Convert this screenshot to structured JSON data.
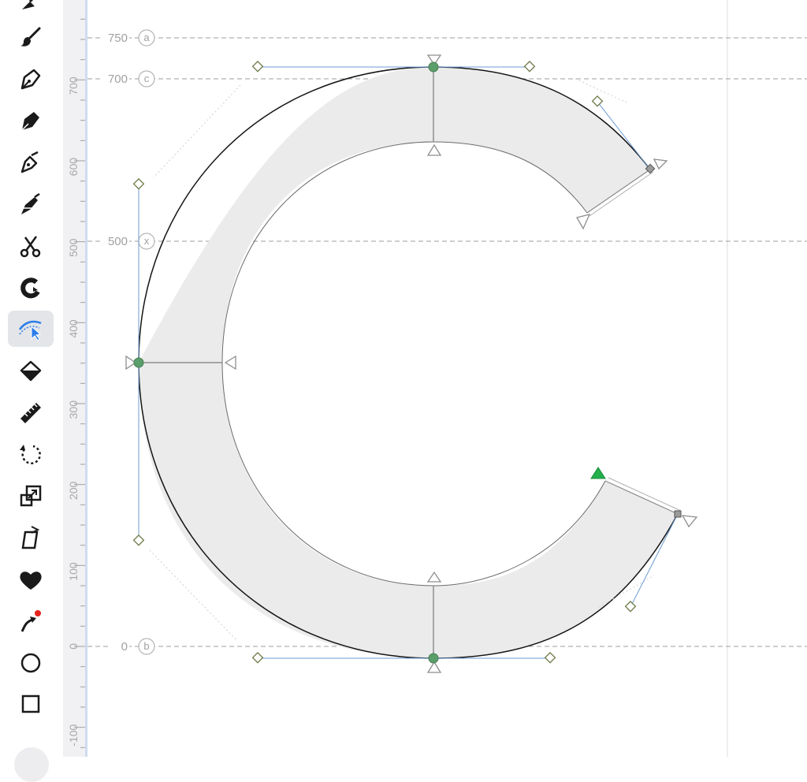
{
  "toolbar": {
    "tools": [
      {
        "name": "brush-tool",
        "icon": "brush-icon"
      },
      {
        "name": "pen-tool",
        "icon": "pen-icon"
      },
      {
        "name": "calligraphy-pen-tool",
        "icon": "calligraphy-pen-icon"
      },
      {
        "name": "fountain-pen-tool",
        "icon": "fountain-pen-icon"
      },
      {
        "name": "knife-pen-tool",
        "icon": "knife-pen-icon"
      },
      {
        "name": "scissors-tool",
        "icon": "scissors-icon"
      },
      {
        "name": "magnet-tool",
        "icon": "magnet-icon"
      },
      {
        "name": "curve-select-tool",
        "icon": "curve-select-icon",
        "active": true
      },
      {
        "name": "fill-tool",
        "icon": "paint-bucket-icon"
      },
      {
        "name": "measure-tool",
        "icon": "ruler-icon"
      },
      {
        "name": "rotate-tool",
        "icon": "rotate-icon"
      },
      {
        "name": "scale-tool",
        "icon": "scale-icon"
      },
      {
        "name": "slant-tool",
        "icon": "slant-icon"
      },
      {
        "name": "heart-shape-tool",
        "icon": "heart-icon"
      },
      {
        "name": "direction-tool",
        "icon": "direction-arrow-icon"
      },
      {
        "name": "ellipse-tool",
        "icon": "circle-icon"
      },
      {
        "name": "rectangle-tool",
        "icon": "square-icon"
      }
    ],
    "accent_color": "#2b7de9"
  },
  "ruler": {
    "ticks": [
      "700",
      "600",
      "500",
      "400",
      "300",
      "200",
      "100",
      "0",
      "-100"
    ]
  },
  "metrics": [
    {
      "value": "750",
      "letter": "a"
    },
    {
      "value": "700",
      "letter": "c"
    },
    {
      "value": "500",
      "letter": "x"
    },
    {
      "value": "0",
      "letter": "b"
    }
  ],
  "glyph": {
    "character": "C",
    "fill_color": "#ebebeb",
    "node_color": "#5a9e6a",
    "start_point_color": "#22b04c",
    "handle_color": "#6b9bd2"
  }
}
